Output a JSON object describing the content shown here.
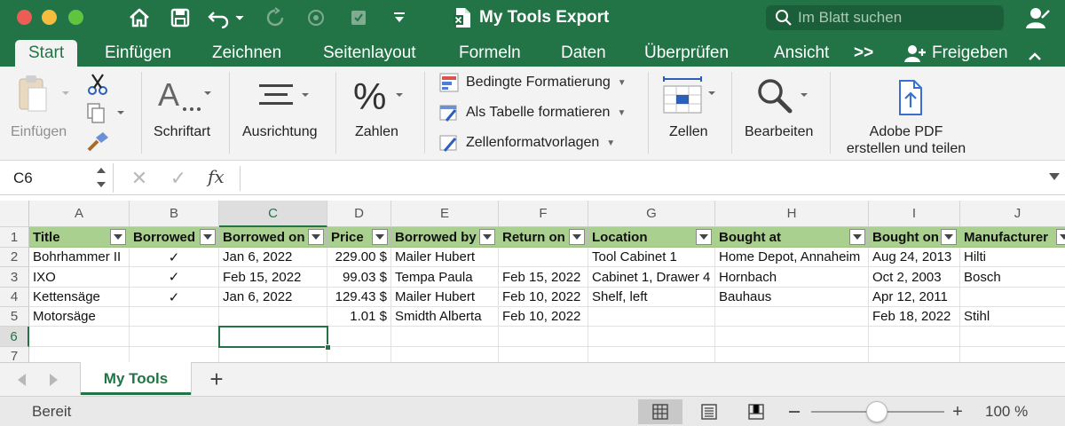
{
  "window": {
    "title": "My Tools Export",
    "search_placeholder": "Im Blatt suchen",
    "app_color": "#227447"
  },
  "tabs": {
    "items": [
      "Start",
      "Einfügen",
      "Zeichnen",
      "Seitenlayout",
      "Formeln",
      "Daten",
      "Überprüfen",
      "Ansicht"
    ],
    "more": ">>",
    "share": "Freigeben",
    "active": "Start"
  },
  "ribbon": {
    "paste": "Einfügen",
    "font": "Schriftart",
    "alignment": "Ausrichtung",
    "numbers": "Zahlen",
    "conditional_formatting": "Bedingte Formatierung",
    "format_as_table": "Als Tabelle formatieren",
    "cell_styles": "Zellenformatvorlagen",
    "cells": "Zellen",
    "editing": "Bearbeiten",
    "pdf_line1": "Adobe PDF",
    "pdf_line2": "erstellen und teilen"
  },
  "formula_bar": {
    "name_box": "C6",
    "fx": "fx",
    "content": ""
  },
  "sheet": {
    "columns": [
      "A",
      "B",
      "C",
      "D",
      "E",
      "F",
      "G",
      "H",
      "I",
      "J"
    ],
    "row_numbers": [
      "1",
      "2",
      "3",
      "4",
      "5",
      "6",
      "7"
    ],
    "selected_cell": "C6",
    "header_color": "#a9d08e",
    "headers": [
      "Title",
      "Borrowed",
      "Borrowed on",
      "Price",
      "Borrowed by",
      "Return on",
      "Location",
      "Bought at",
      "Bought on",
      "Manufacturer"
    ],
    "rows": [
      [
        "Bohrhammer II",
        "✓",
        "Jan 6, 2022",
        "229.00 $",
        "Mailer Hubert",
        "",
        "Tool Cabinet 1",
        "Home Depot, Annaheim",
        "Aug 24, 2013",
        "Hilti"
      ],
      [
        "IXO",
        "✓",
        "Feb 15, 2022",
        "99.03 $",
        "Tempa Paula",
        "Feb 15, 2022",
        "Cabinet 1, Drawer 4",
        "Hornbach",
        "Oct 2, 2003",
        "Bosch"
      ],
      [
        "Kettensäge",
        "✓",
        "Jan 6, 2022",
        "129.43 $",
        "Mailer Hubert",
        "Feb 10, 2022",
        "Shelf, left",
        "Bauhaus",
        "Apr 12, 2011",
        ""
      ],
      [
        "Motorsäge",
        "",
        "",
        "1.01 $",
        "Smidth Alberta",
        "Feb 10, 2022",
        "",
        "",
        "Feb 18, 2022",
        "Stihl"
      ]
    ]
  },
  "sheet_tabs": {
    "active": "My Tools",
    "add": "+"
  },
  "status": {
    "text": "Bereit",
    "zoom": "100 %",
    "zoom_level_percent": 100
  }
}
